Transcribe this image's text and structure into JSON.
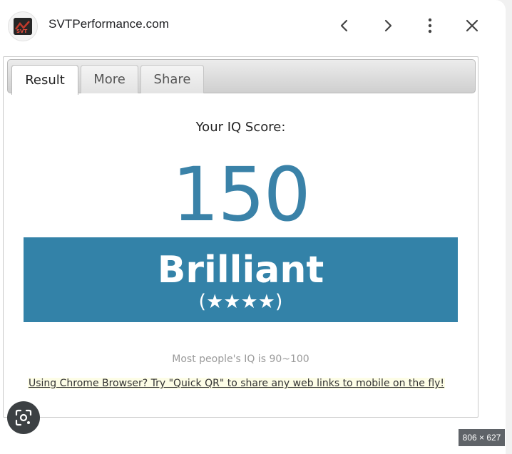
{
  "header": {
    "site_name": "SVTPerformance.com",
    "logo_text": "SVT",
    "icons": [
      "chevron-left-icon",
      "chevron-right-icon",
      "more-vert-icon",
      "close-icon"
    ]
  },
  "tabs": [
    {
      "label": "Result",
      "active": true
    },
    {
      "label": "More",
      "active": false
    },
    {
      "label": "Share",
      "active": false
    }
  ],
  "result": {
    "label": "Your IQ Score:",
    "score": "150",
    "rating": "Brilliant",
    "stars": "(★★★★)",
    "note": "Most people's IQ is 90~100"
  },
  "promo": {
    "text": "Using Chrome Browser? Try \"Quick QR\" to share any web links to mobile on the fly!"
  },
  "image_dimensions": "806 × 627",
  "colors": {
    "score": "#3a82a8",
    "banner": "#3382a8",
    "promo_bg": "#fdfde6"
  }
}
